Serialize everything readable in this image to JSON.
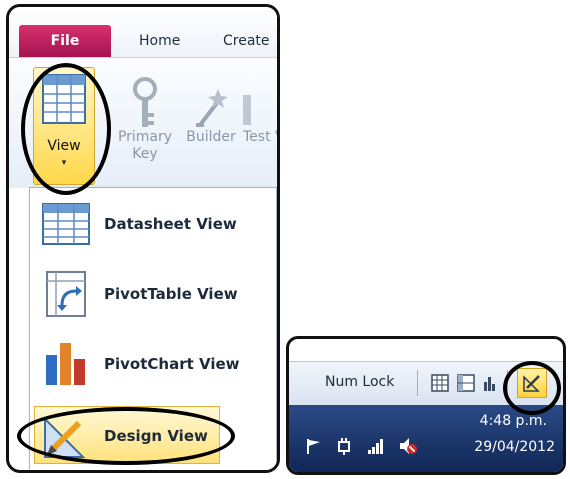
{
  "ribbon": {
    "tabs": [
      {
        "label": "File"
      },
      {
        "label": "Home"
      },
      {
        "label": "Create"
      }
    ],
    "view_button": {
      "label": "View",
      "arrow": "▾"
    },
    "tools": [
      {
        "label_line1": "Primary",
        "label_line2": "Key",
        "icon": "key-icon"
      },
      {
        "label_line1": "Builder",
        "label_line2": "",
        "icon": "builder-wand-icon"
      },
      {
        "label_line1": "Test V",
        "label_line2": "",
        "icon": "test-validation-icon"
      }
    ]
  },
  "view_menu": {
    "items": [
      {
        "label": "Datasheet View",
        "icon": "datasheet-grid-icon"
      },
      {
        "label": "PivotTable View",
        "icon": "pivottable-icon"
      },
      {
        "label": "PivotChart View",
        "icon": "pivotchart-icon"
      },
      {
        "label": "Design View",
        "icon": "design-ruler-pencil-icon"
      }
    ]
  },
  "status_bar": {
    "num_lock": "Num Lock",
    "view_icons": [
      "datasheet-view-icon",
      "pivottable-view-icon",
      "pivotchart-view-icon",
      "design-view-icon"
    ]
  },
  "taskbar": {
    "time": "4:48 p.m.",
    "date": "29/04/2012",
    "tray_icons": [
      "action-center-flag-icon",
      "power-plug-icon",
      "network-signal-icon",
      "volume-muted-icon"
    ]
  },
  "colors": {
    "file_tab": "#c21e5e",
    "highlight": "#ffd84a",
    "taskbar": "#1a3468",
    "ribbon": "#e6eef8"
  }
}
